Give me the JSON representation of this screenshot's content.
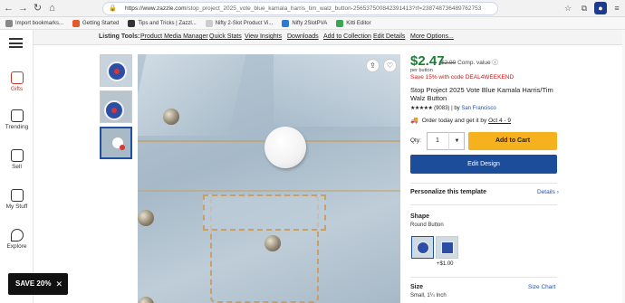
{
  "browser": {
    "url_host": "https://www.zazzle.com",
    "url_path": "/stop_project_2025_vote_blue_kamala_harris_tim_walz_button-256537500842391413?rf=238748736489762753",
    "bookmarks": [
      "Import bookmarks...",
      "Getting Started",
      "Tips and Tricks | Zazzl...",
      "Nifty 2-Slot Product Vi...",
      "Nifty 2SlotPVA",
      "Kitti Editor"
    ]
  },
  "listing_tools": {
    "title": "Listing Tools:",
    "links": [
      "Product Media Manager",
      "Quick Stats",
      "View Insights",
      "Downloads",
      "Add to Collection",
      "Edit Details",
      "More Options..."
    ]
  },
  "sidebar": {
    "items": [
      {
        "label": "Gifts",
        "icon": "gift-icon"
      },
      {
        "label": "Trending",
        "icon": "trending-icon"
      },
      {
        "label": "Sell",
        "icon": "sell-icon"
      },
      {
        "label": "My Stuff",
        "icon": "folder-icon"
      },
      {
        "label": "Explore",
        "icon": "location-icon"
      }
    ]
  },
  "product": {
    "price": "$2.47",
    "old_price": "$2.90",
    "comp_value": "Comp. value",
    "per": "per button",
    "save_text": "Save 15% with code DEAL4WEEKEND",
    "title": "Stop Project 2025 Vote Blue Kamala Harris/Tim Walz Button",
    "stars": "★★★★★",
    "rating_count": "(9083)",
    "by": "by",
    "seller": "San Francisco",
    "delivery_text": "Order today and get it by",
    "delivery_date": "Oct 4 - 9",
    "qty_label": "Qty:",
    "qty_value": "1",
    "add_to_cart": "Add to Cart",
    "edit_design": "Edit Design",
    "personalize": "Personalize this template",
    "details_link": "Details",
    "shape_title": "Shape",
    "shape_value": "Round Button",
    "shape_option_price": "+$1.00",
    "size_title": "Size",
    "size_chart": "Size Chart",
    "size_value": "Small, 1¼ Inch"
  },
  "promo": {
    "label": "SAVE 20%",
    "close": "✕"
  },
  "colors": {
    "price_green": "#1a7f32",
    "save_red": "#d21414",
    "cart_yellow": "#f5b21e",
    "edit_blue": "#1c4d9a"
  }
}
